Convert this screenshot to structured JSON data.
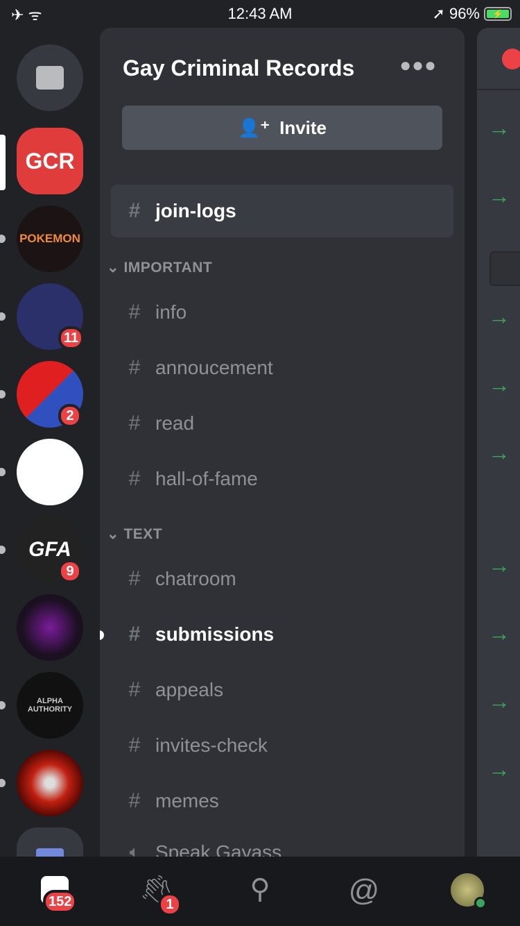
{
  "status_bar": {
    "time": "12:43 AM",
    "battery": "96%"
  },
  "servers": [
    {
      "name": "Direct Messages",
      "icon": "chat-bubble-icon"
    },
    {
      "name": "Gay Criminal Records",
      "label": "GCR",
      "color": "#e03c3c",
      "selected": true
    },
    {
      "name": "Pokemon",
      "label": "POKEMON",
      "unread": true
    },
    {
      "name": "server-3",
      "badge": "11",
      "unread": true
    },
    {
      "name": "server-4",
      "badge": "2",
      "unread": true
    },
    {
      "name": "server-5",
      "unread": true
    },
    {
      "name": "GFA",
      "label": "GFA",
      "badge": "9",
      "unread": true
    },
    {
      "name": "server-7"
    },
    {
      "name": "Alpha Authority",
      "label": "ALPHA AUTHORITY",
      "unread": true
    },
    {
      "name": "server-9",
      "unread": true
    },
    {
      "name": "folder",
      "icon": "folder-icon"
    }
  ],
  "guild": {
    "title": "Gay Criminal Records",
    "invite_label": "Invite"
  },
  "channels": {
    "top": {
      "name": "join-logs"
    },
    "categories": [
      {
        "name": "IMPORTANT",
        "items": [
          "info",
          "annoucement",
          "read",
          "hall-of-fame"
        ]
      },
      {
        "name": "TEXT",
        "items": [
          "chatroom",
          "submissions",
          "appeals",
          "invites-check",
          "memes"
        ]
      }
    ],
    "unread": "submissions",
    "voice": "Speak Gayass"
  },
  "tabbar": {
    "home_badge": "152",
    "friends_badge": "1"
  },
  "colors": {
    "accent_red": "#ed4245",
    "online": "#3ba55d"
  }
}
